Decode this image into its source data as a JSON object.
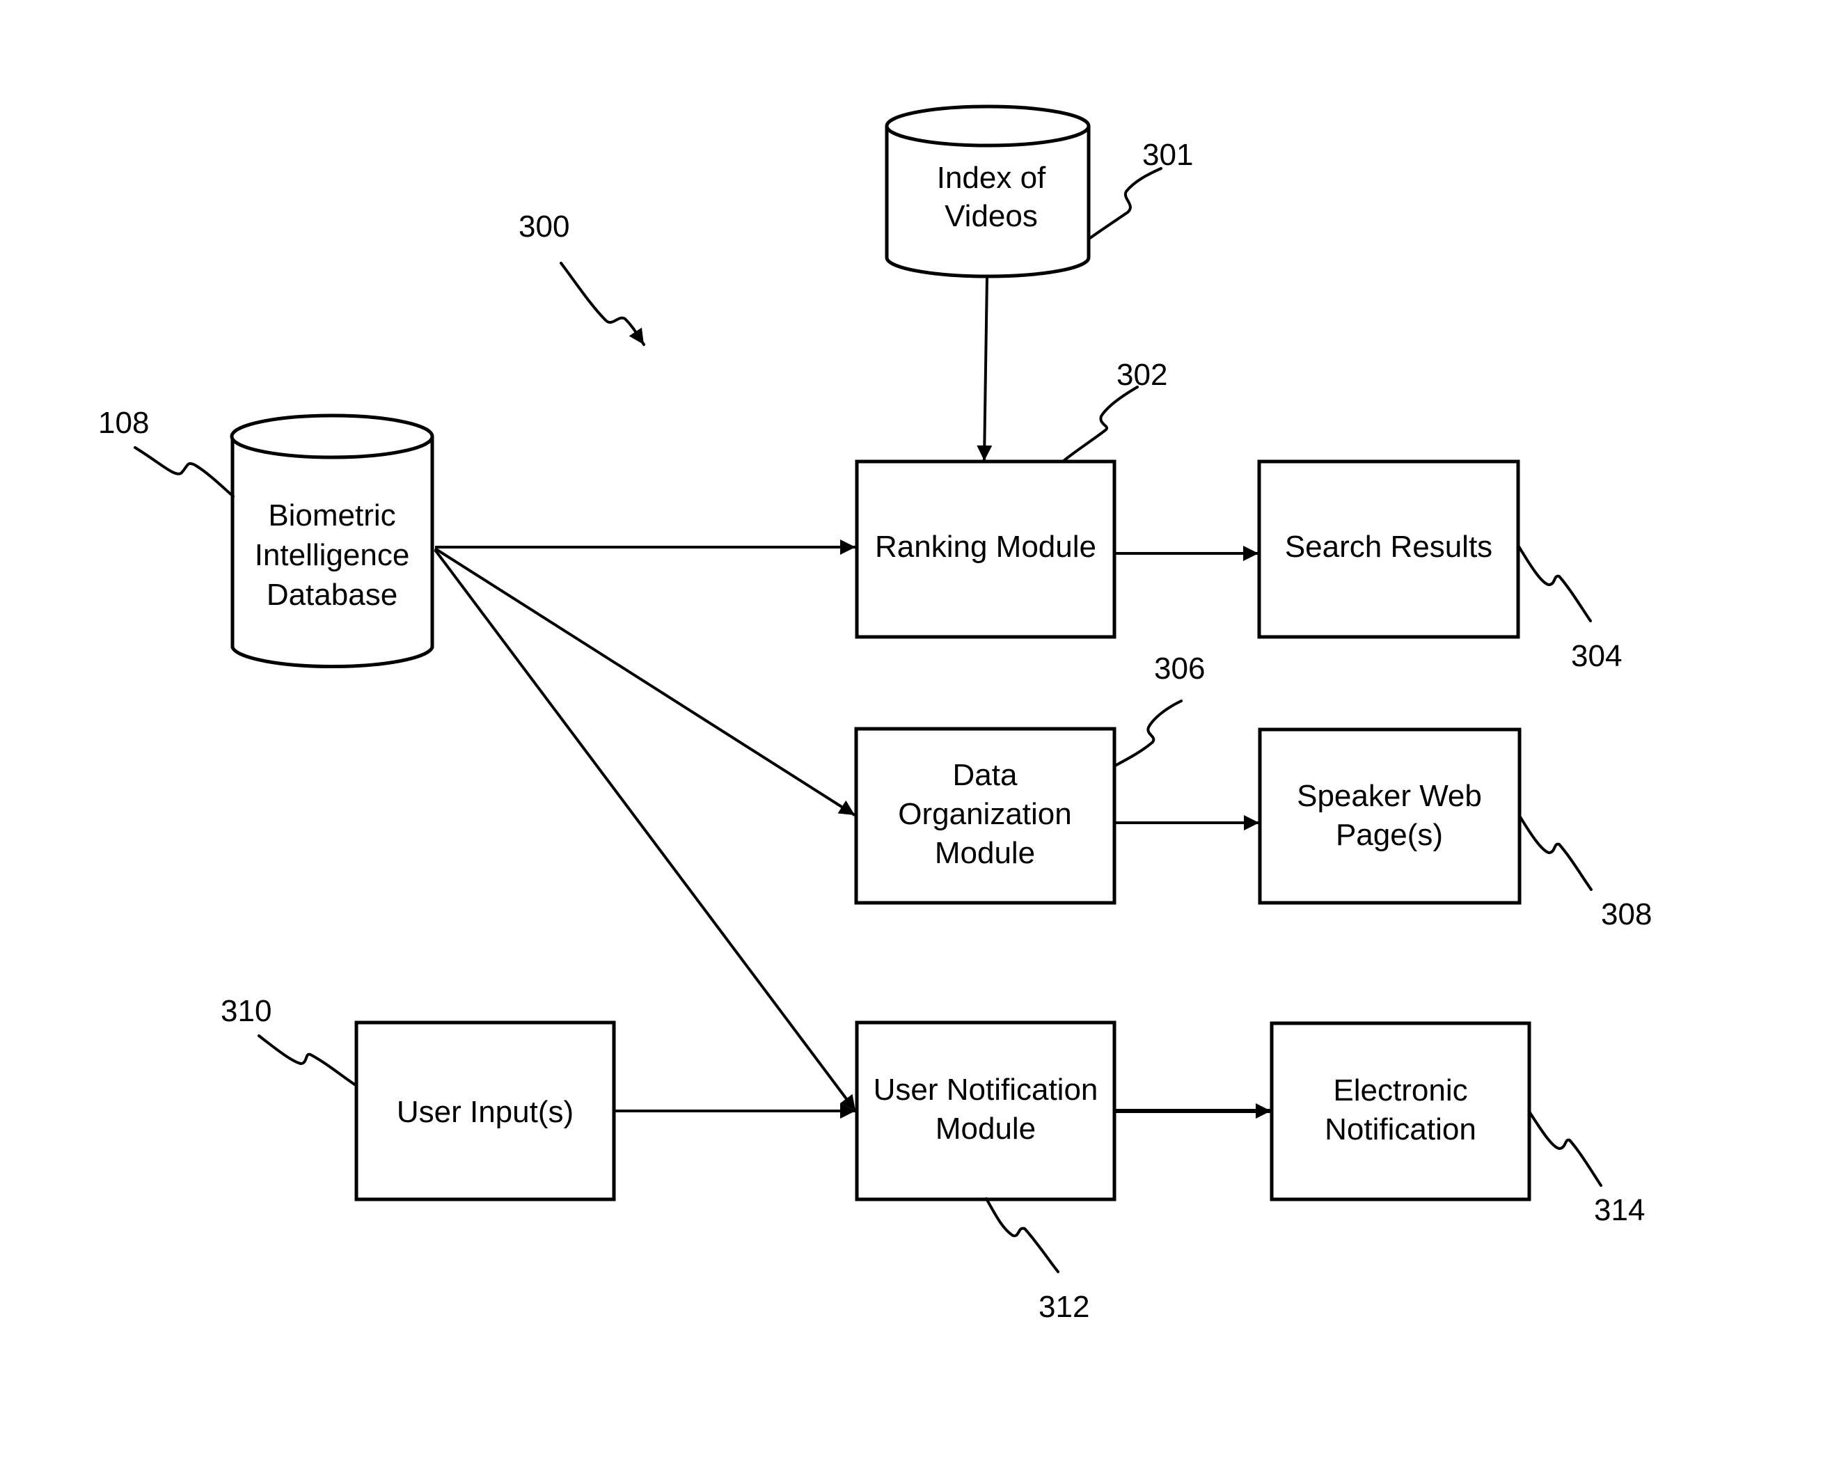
{
  "figure": {
    "ref": "300",
    "nodes": {
      "biometric_db": {
        "ref": "108",
        "lines": [
          "Biometric",
          "Intelligence",
          "Database"
        ],
        "shape": "cylinder"
      },
      "index_videos": {
        "ref": "301",
        "lines": [
          "Index of",
          "Videos"
        ],
        "shape": "cylinder"
      },
      "ranking_module": {
        "ref": "302",
        "lines": [
          "Ranking Module"
        ],
        "shape": "box"
      },
      "search_results": {
        "ref": "304",
        "lines": [
          "Search Results"
        ],
        "shape": "box"
      },
      "data_org_module": {
        "ref": "306",
        "lines": [
          "Data",
          "Organization",
          "Module"
        ],
        "shape": "box"
      },
      "speaker_pages": {
        "ref": "308",
        "lines": [
          "Speaker Web",
          "Page(s)"
        ],
        "shape": "box"
      },
      "user_inputs": {
        "ref": "310",
        "lines": [
          "User Input(s)"
        ],
        "shape": "box"
      },
      "user_notification_module": {
        "ref": "312",
        "lines": [
          "User Notification",
          "Module"
        ],
        "shape": "box"
      },
      "electronic_notification": {
        "ref": "314",
        "lines": [
          "Electronic",
          "Notification"
        ],
        "shape": "box"
      }
    },
    "edges": [
      {
        "from": "index_videos",
        "to": "ranking_module"
      },
      {
        "from": "biometric_db",
        "to": "ranking_module"
      },
      {
        "from": "biometric_db",
        "to": "data_org_module"
      },
      {
        "from": "biometric_db",
        "to": "user_notification_module"
      },
      {
        "from": "ranking_module",
        "to": "search_results"
      },
      {
        "from": "data_org_module",
        "to": "speaker_pages"
      },
      {
        "from": "user_inputs",
        "to": "user_notification_module"
      },
      {
        "from": "user_notification_module",
        "to": "electronic_notification"
      }
    ]
  }
}
